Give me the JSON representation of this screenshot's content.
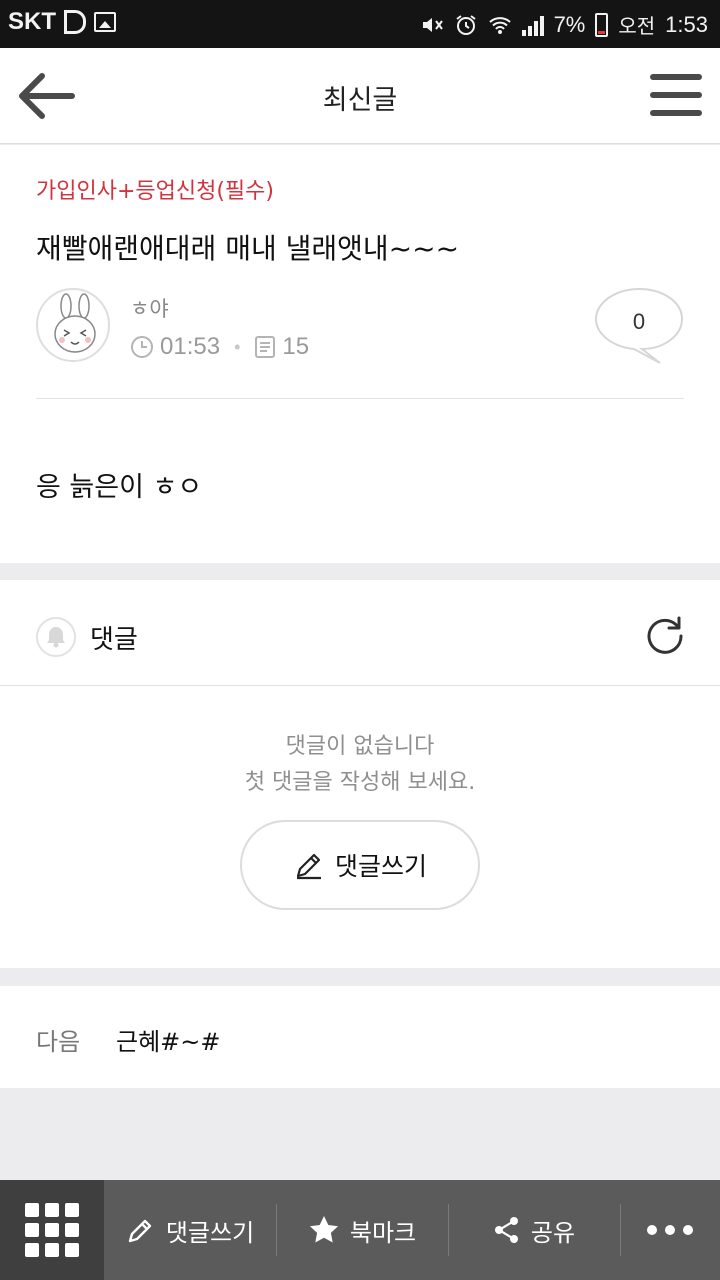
{
  "status_bar": {
    "carrier": "SKT",
    "battery": "7%",
    "ampm": "오전",
    "time": "1:53"
  },
  "header": {
    "title": "최신글"
  },
  "post": {
    "category": "가입인사+등업신청(필수)",
    "title": "재빨애랜애대래 매내 낼래앳내~~~",
    "author": "ㅎ야",
    "time": "01:53",
    "views": "15",
    "comment_count": "0",
    "body": "응 늙은이 ㅎㅇ"
  },
  "comments": {
    "label": "댓글",
    "empty_line1": "댓글이 없습니다",
    "empty_line2": "첫 댓글을 작성해 보세요.",
    "write_button": "댓글쓰기"
  },
  "next": {
    "label": "다음",
    "title": "근혜#~#"
  },
  "bottom_bar": {
    "write": "댓글쓰기",
    "bookmark": "북마크",
    "share": "공유"
  },
  "colors": {
    "category_red": "#d2343f",
    "status_bar_bg": "#141414",
    "bottom_bar_bg": "#5b5b5b"
  }
}
